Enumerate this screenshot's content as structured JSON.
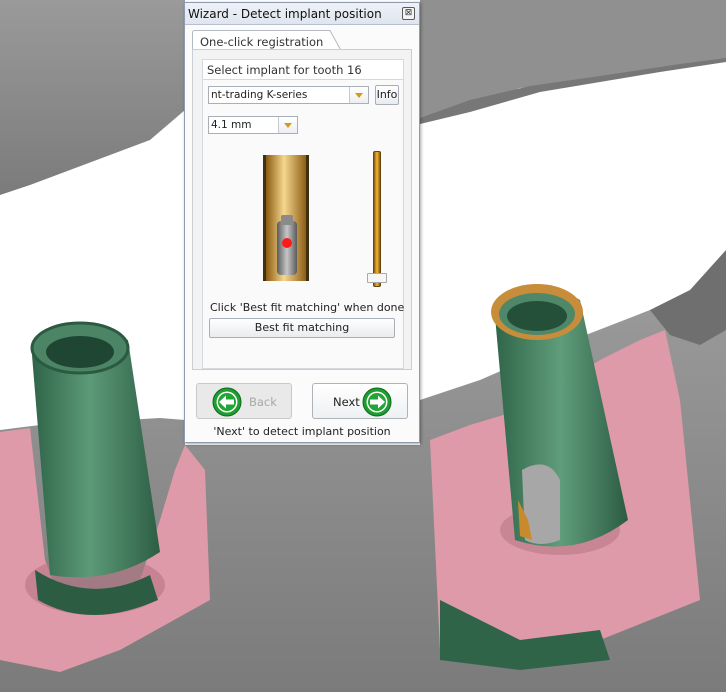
{
  "window": {
    "title": "Wizard - Detect implant position",
    "close_glyph": "⊠"
  },
  "tabs": [
    {
      "label": "One-click registration",
      "active": true
    }
  ],
  "section": {
    "title": "Select implant for tooth 16"
  },
  "implant_select": {
    "value": "nt-trading K-series",
    "info_label": "Info"
  },
  "diameter_select": {
    "value": "4.1 mm"
  },
  "preview": {
    "slider_level": 0.95
  },
  "instruction": "Click 'Best fit matching' when done",
  "best_fit_label": "Best fit matching",
  "nav": {
    "back_label": "Back",
    "next_label": "Next",
    "back_enabled": false
  },
  "footer_hint": "'Next' to detect implant position",
  "icons": {
    "back": "back-arrow-icon",
    "next": "next-arrow-icon",
    "close": "close-icon",
    "dropdown": "chevron-down-icon"
  },
  "colors": {
    "gum": "#de9aa8",
    "stone": "#8b8b8b",
    "scanbody": "#4f8a68",
    "nav_green": "#22a535",
    "accent_gold": "#d79a18"
  }
}
